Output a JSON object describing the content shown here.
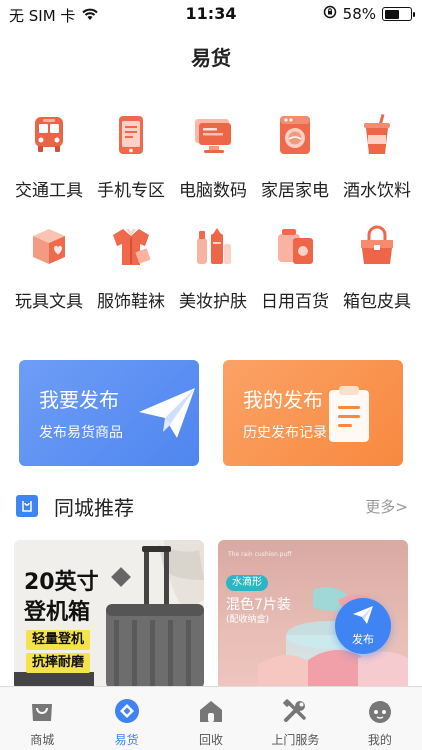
{
  "status_bar": {
    "carrier": "无 SIM 卡",
    "time": "11:34",
    "battery_text": "58%",
    "battery_level": 0.58,
    "wifi_icon": "wifi-icon",
    "lock_icon": "rotation-lock-icon"
  },
  "header": {
    "title": "易货"
  },
  "categories": [
    {
      "label": "交通工具",
      "icon": "bus-icon"
    },
    {
      "label": "手机专区",
      "icon": "phone-icon"
    },
    {
      "label": "电脑数码",
      "icon": "computer-icon"
    },
    {
      "label": "家居家电",
      "icon": "washing-machine-icon"
    },
    {
      "label": "酒水饮料",
      "icon": "drink-cup-icon"
    },
    {
      "label": "玩具文具",
      "icon": "toy-box-icon"
    },
    {
      "label": "服饰鞋袜",
      "icon": "clothing-icon"
    },
    {
      "label": "美妆护肤",
      "icon": "cosmetics-icon"
    },
    {
      "label": "日用百货",
      "icon": "daily-goods-icon"
    },
    {
      "label": "箱包皮具",
      "icon": "handbag-icon"
    }
  ],
  "publish_cards": {
    "new": {
      "title": "我要发布",
      "subtitle": "发布易货商品",
      "icon": "paper-plane-icon"
    },
    "mine": {
      "title": "我的发布",
      "subtitle": "历史发布记录",
      "icon": "clipboard-icon"
    }
  },
  "section": {
    "title": "同城推荐",
    "more": "更多>",
    "icon": "bag-icon"
  },
  "products": [
    {
      "headline_1": "20英寸",
      "headline_2": "登机箱",
      "tag_1": "轻量登机",
      "tag_2": "抗摔耐磨"
    },
    {
      "small_text": "The rain cushion puff",
      "badge": "水滴形",
      "main": "混色7片装",
      "sub": "(配收纳盒)"
    }
  ],
  "fab": {
    "label": "发布",
    "icon": "paper-plane-icon"
  },
  "tabbar": {
    "active": "易货",
    "items": [
      {
        "label": "商城",
        "icon": "shopping-bag-icon"
      },
      {
        "label": "易货",
        "icon": "exchange-icon"
      },
      {
        "label": "回收",
        "icon": "home-icon"
      },
      {
        "label": "上门服务",
        "icon": "tools-icon"
      },
      {
        "label": "我的",
        "icon": "profile-icon"
      }
    ]
  },
  "colors": {
    "accent": "#3f84f2",
    "category_orange": "#ef6a4c",
    "card_blue": "#5b8ff1",
    "card_orange": "#f8944d"
  }
}
